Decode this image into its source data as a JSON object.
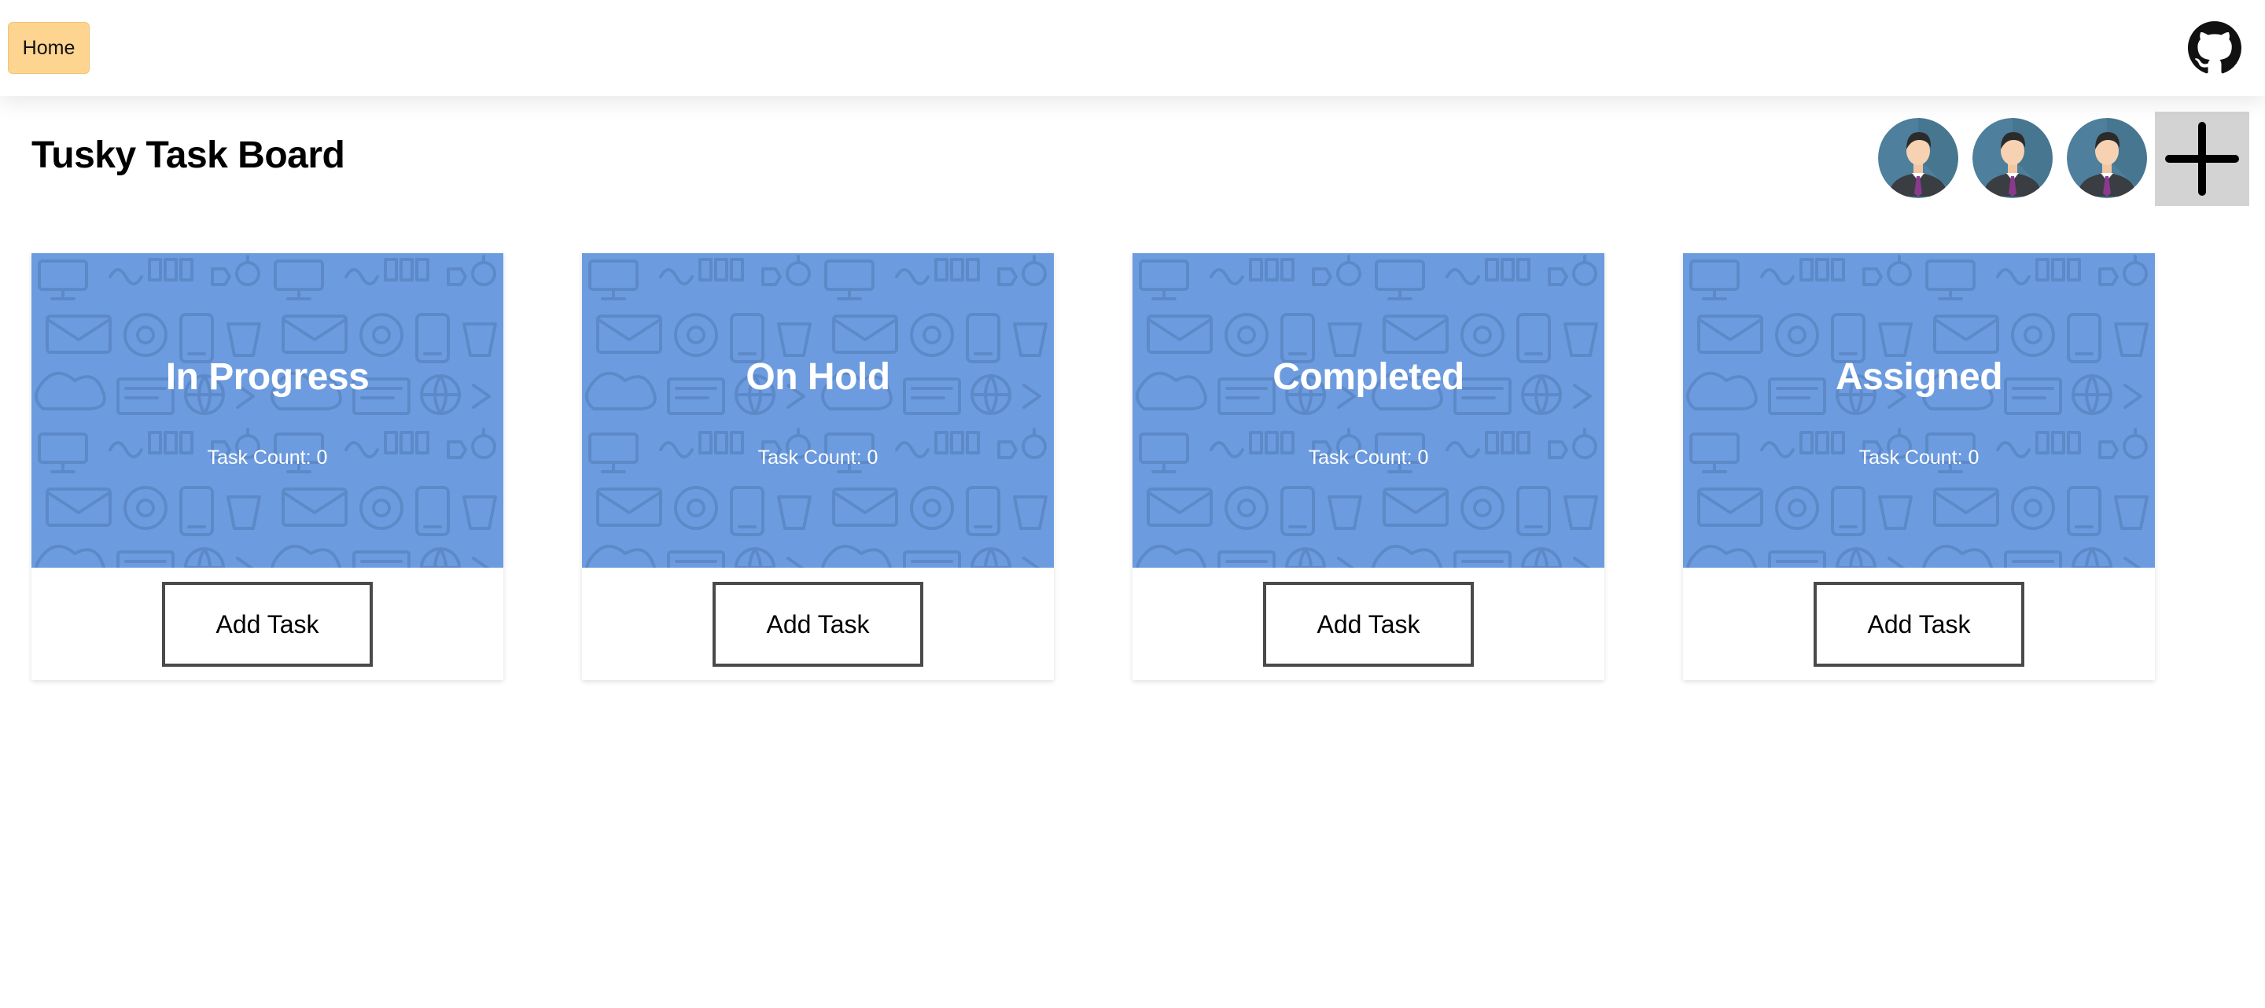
{
  "navbar": {
    "home_label": "Home",
    "github_icon": "github-icon"
  },
  "header": {
    "title": "Tusky Task Board",
    "avatars": [
      "avatar",
      "avatar",
      "avatar"
    ],
    "add_user_icon": "plus-icon"
  },
  "columns": [
    {
      "title": "In Progress",
      "count_text": "Task Count: 0",
      "button_label": "Add Task"
    },
    {
      "title": "On Hold",
      "count_text": "Task Count: 0",
      "button_label": "Add Task"
    },
    {
      "title": "Completed",
      "count_text": "Task Count: 0",
      "button_label": "Add Task"
    },
    {
      "title": "Assigned",
      "count_text": "Task Count: 0",
      "button_label": "Add Task"
    }
  ],
  "colors": {
    "home_button": "#fdd490",
    "column_header": "#6c9cdf",
    "add_user_bg": "#d3d3d3"
  }
}
